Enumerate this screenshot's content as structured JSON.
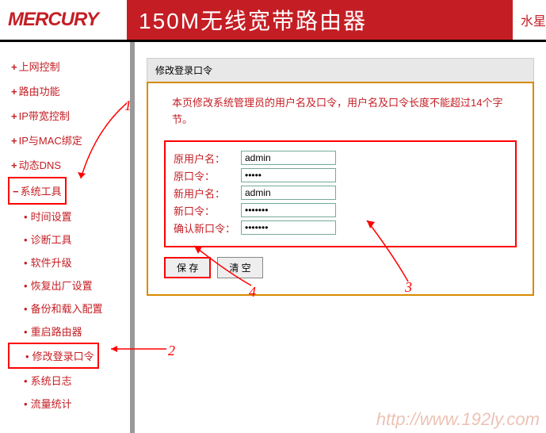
{
  "header": {
    "logo": "MERCURY",
    "title": "150M无线宽带路由器",
    "subtitle": "水星"
  },
  "sidebar": {
    "items": [
      {
        "label": "上网控制",
        "type": "plus"
      },
      {
        "label": "路由功能",
        "type": "plus"
      },
      {
        "label": "IP带宽控制",
        "type": "plus"
      },
      {
        "label": "IP与MAC绑定",
        "type": "plus"
      },
      {
        "label": "动态DNS",
        "type": "plus"
      },
      {
        "label": "系统工具",
        "type": "minus",
        "highlight": true
      }
    ],
    "subitems": [
      {
        "label": "时间设置"
      },
      {
        "label": "诊断工具"
      },
      {
        "label": "软件升级"
      },
      {
        "label": "恢复出厂设置"
      },
      {
        "label": "备份和载入配置"
      },
      {
        "label": "重启路由器"
      },
      {
        "label": "修改登录口令",
        "highlight": true
      },
      {
        "label": "系统日志"
      },
      {
        "label": "流量统计"
      }
    ]
  },
  "panel": {
    "title": "修改登录口令",
    "instruction": "本页修改系统管理员的用户名及口令，用户名及口令长度不能超过14个字节。"
  },
  "form": {
    "old_user_label": "原用户名：",
    "old_user_value": "admin",
    "old_pass_label": "原口令：",
    "old_pass_value": "•••••",
    "new_user_label": "新用户名：",
    "new_user_value": "admin",
    "new_pass_label": "新口令：",
    "new_pass_value": "•••••••",
    "confirm_pass_label": "确认新口令：",
    "confirm_pass_value": "•••••••"
  },
  "buttons": {
    "save": "保 存",
    "clear": "清 空"
  },
  "annotations": {
    "n1": "1",
    "n2": "2",
    "n3": "3",
    "n4": "4"
  },
  "watermark": "http://www.192ly.com"
}
